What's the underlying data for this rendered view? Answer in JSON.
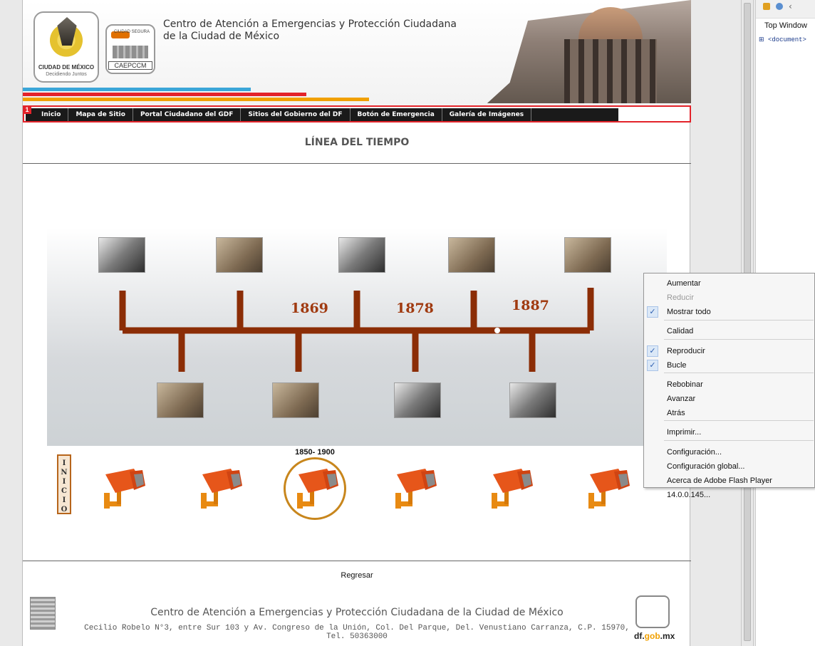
{
  "header": {
    "title_line1": "Centro de Atención a Emergencias y Protección Ciudadana",
    "title_line2": "de la Ciudad de México",
    "logo1_text": "CIUDAD DE MÉXICO",
    "logo1_sub": "Decidiendo Juntos",
    "logo2_text": "CAEPCCM",
    "logo2_tag": "CIUDAD SEGURA",
    "stripe_colors": [
      "#3aa6d8",
      "#e3232a",
      "#f1a000"
    ]
  },
  "nav": {
    "badge": "1",
    "items": [
      "Inicio",
      "Mapa de Sitio",
      "Portal Ciudadano del GDF",
      "Sitios del Gobierno del DF",
      "Botón de Emergencia",
      "Galería de Imágenes"
    ]
  },
  "main": {
    "heading": "LÍNEA DEL TIEMPO",
    "years": [
      "1869",
      "1878",
      "1887"
    ],
    "range_label": "1850- 1900",
    "inicio": "INICIO",
    "accent": "#a03a10"
  },
  "footer": {
    "back": "Regresar",
    "line1": "Centro de Atención a Emergencias y Protección Ciudadana de la Ciudad de México",
    "line2": "Cecilio Robelo N°3, entre Sur 103 y Av. Congreso de la Unión, Col. Del Parque, Del. Venustiano Carranza, C.P. 15970, Tel. 50363000",
    "domain_a": "df.",
    "domain_b": "gob",
    "domain_c": ".mx"
  },
  "devtools": {
    "tab": "Top Window",
    "tree_node": "<document>"
  },
  "context_menu": {
    "items": [
      {
        "label": "Aumentar",
        "checked": false,
        "disabled": false
      },
      {
        "label": "Reducir",
        "checked": false,
        "disabled": true
      },
      {
        "label": "Mostrar todo",
        "checked": true,
        "disabled": false
      },
      {
        "label": "Calidad",
        "checked": false,
        "disabled": false
      },
      {
        "label": "Reproducir",
        "checked": true,
        "disabled": false
      },
      {
        "label": "Bucle",
        "checked": true,
        "disabled": false
      },
      {
        "label": "Rebobinar",
        "checked": false,
        "disabled": false
      },
      {
        "label": "Avanzar",
        "checked": false,
        "disabled": false
      },
      {
        "label": "Atrás",
        "checked": false,
        "disabled": false
      },
      {
        "label": "Imprimir...",
        "checked": false,
        "disabled": false
      },
      {
        "label": "Configuración...",
        "checked": false,
        "disabled": false
      },
      {
        "label": "Configuración global...",
        "checked": false,
        "disabled": false
      },
      {
        "label": "Acerca de Adobe Flash Player 14.0.0.145...",
        "checked": false,
        "disabled": false
      }
    ]
  }
}
